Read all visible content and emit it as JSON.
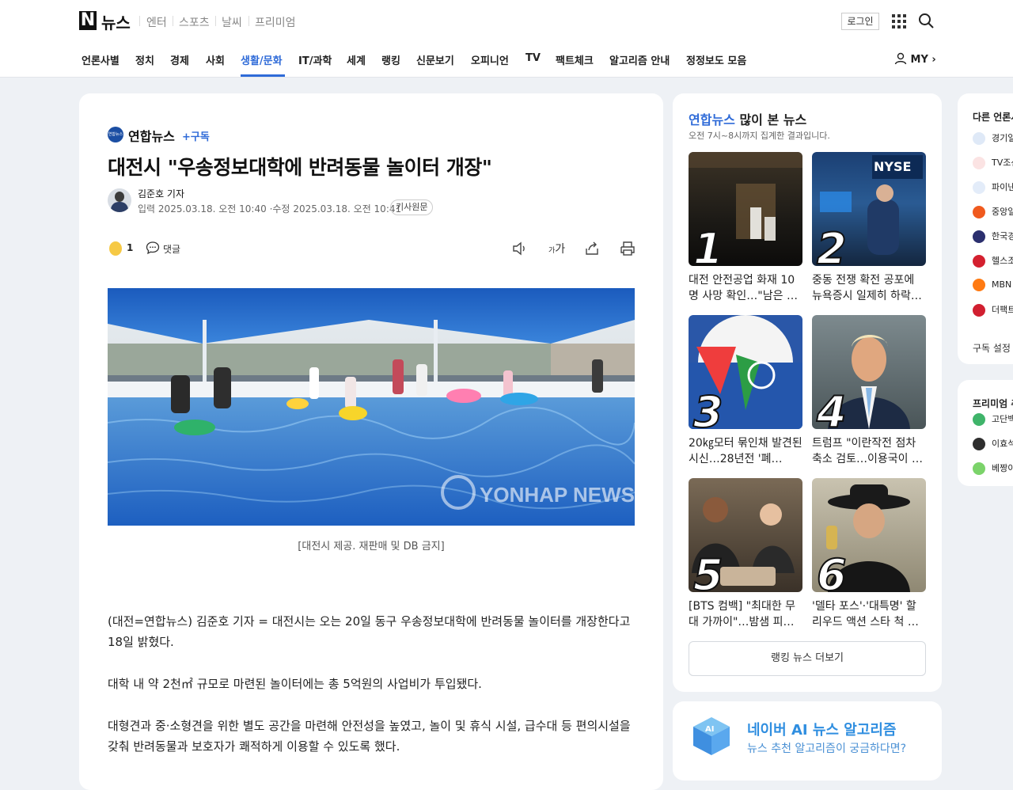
{
  "header": {
    "logo": "N",
    "title": "뉴스",
    "services": [
      "엔터",
      "스포츠",
      "날씨",
      "프리미엄"
    ],
    "login_label": "로그인",
    "menu": [
      "언론사별",
      "정치",
      "경제",
      "사회",
      "생활/문화",
      "IT/과학",
      "세계",
      "랭킹",
      "신문보기",
      "오피니언",
      "TV",
      "팩트체크",
      "알고리즘 안내",
      "정정보도 모음"
    ],
    "active_menu": "생활/문화",
    "my_label": "MY"
  },
  "article": {
    "press_name": "연합뉴스",
    "press_logo_text": "연합뉴스",
    "subscribe_label": "+구독",
    "headline": "대전시 \"우송정보대학에 반려동물 놀이터 개장\"",
    "reporter": "김준호 기자",
    "input_label": "입력",
    "input_time": "2025.03.18. 오전 10:40",
    "edit_label": "수정",
    "edit_time": "2025.03.18. 오전 10:41",
    "original_label": "기사원문",
    "reaction_count": "1",
    "comment_label": "댓글",
    "font_tool": "가",
    "photo_watermark": "YONHAP NEWS",
    "caption": "[대전시 제공. 재판매 및 DB 금지]",
    "paragraphs": [
      "(대전=연합뉴스) 김준호 기자 = 대전시는 오는 20일 동구 우송정보대학에 반려동물 놀이터를 개장한다고 18일 밝혔다.",
      "대학 내 약 2천㎡ 규모로 마련된 놀이터에는 총 5억원의 사업비가 투입됐다.",
      "대형견과 중·소형견을 위한 별도 공간을 마련해 안전성을 높였고, 놀이 및 휴식 시설, 급수대 등 편의시설을 갖춰 반려동물과 보호자가 쾌적하게 이용할 수 있도록 했다."
    ]
  },
  "ranking": {
    "title_press": "연합뉴스",
    "title_rest": " 많이 본 뉴스",
    "subtitle": "오전 7시~8시까지 집계한 결과입니다.",
    "items": [
      {
        "rank": "1",
        "text": "대전 안전공업 화재 10명 사망 확인…\"남은 …"
      },
      {
        "rank": "2",
        "text": "중동 전쟁 확전 공포에 뉴욕증시 일제히 하락…"
      },
      {
        "rank": "3",
        "text": "20㎏모터 묶인채 발견된 시신…28년전 '폐…"
      },
      {
        "rank": "4",
        "text": "트럼프 \"이란작전 점차 축소 검토…이용국이 …"
      },
      {
        "rank": "5",
        "text": "[BTS 컴백] \"최대한 무대 가까이\"…밤샘 피…"
      },
      {
        "rank": "6",
        "text": "'델타 포스'·'대특명' 할리우드 액션 스타 척 …"
      }
    ],
    "more_label": "랭킹 뉴스 더보기",
    "thumb_labels": [
      "NYSE"
    ]
  },
  "ai_card": {
    "title": "네이버 AI 뉴스 알고리즘",
    "subtitle": "뉴스 추천 알고리즘이 궁금하다면?",
    "logo_text": "AI"
  },
  "other_press": {
    "title": "다른 언론사",
    "items": [
      "경기일",
      "TV조선",
      "파이낸",
      "중앙일",
      "한국경",
      "헬스조",
      "MBN",
      "더팩트"
    ],
    "settings_label": "구독 설정"
  },
  "premium": {
    "title": "프리미엄 추",
    "items": [
      "고단백",
      "이효석",
      "베짱이"
    ]
  },
  "colors": {
    "accent": "#2f6bd8",
    "page_bg": "#eef1f5"
  }
}
